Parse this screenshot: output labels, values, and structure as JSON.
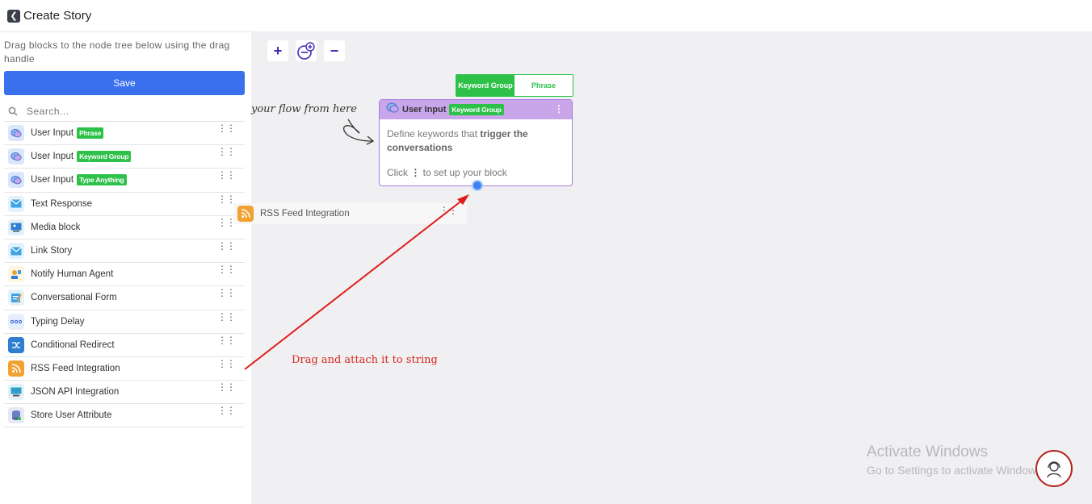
{
  "header": {
    "title": "Create Story",
    "back_icon": "arrow-left-icon"
  },
  "sidebar": {
    "hint": "Drag blocks to the node tree below using the drag handle",
    "save_label": "Save",
    "search_placeholder": "Search...",
    "blocks": [
      {
        "label": "User Input",
        "tag": "Phrase",
        "icon": "chat-bubble-icon"
      },
      {
        "label": "User Input",
        "tag": "Keyword Group",
        "icon": "chat-bubble-icon"
      },
      {
        "label": "User Input",
        "tag": "Type Anything",
        "icon": "chat-bubble-icon"
      },
      {
        "label": "Text Response",
        "tag": "",
        "icon": "envelope-icon"
      },
      {
        "label": "Media block",
        "tag": "",
        "icon": "media-icon"
      },
      {
        "label": "Link Story",
        "tag": "",
        "icon": "envelope-icon"
      },
      {
        "label": "Notify Human Agent",
        "tag": "",
        "icon": "agent-icon"
      },
      {
        "label": "Conversational Form",
        "tag": "",
        "icon": "form-icon"
      },
      {
        "label": "Typing Delay",
        "tag": "",
        "icon": "typing-dots-icon"
      },
      {
        "label": "Conditional Redirect",
        "tag": "",
        "icon": "shuffle-icon"
      },
      {
        "label": "RSS Feed Integration",
        "tag": "",
        "icon": "rss-icon"
      },
      {
        "label": "JSON API Integration",
        "tag": "",
        "icon": "api-monitor-icon"
      },
      {
        "label": "Store User Attribute",
        "tag": "",
        "icon": "database-icon"
      }
    ]
  },
  "canvas": {
    "start_label": "your flow from here",
    "toggle": {
      "active": "Keyword Group",
      "inactive": "Phrase"
    },
    "node": {
      "title": "User Input",
      "tag": "Keyword Group",
      "body_plain": "Define keywords that ",
      "body_bold": "trigger the conversations",
      "click_pre": "Click ",
      "click_post": " to set up your block"
    },
    "dragging_block": "RSS Feed Integration",
    "annotation": "Drag and attach it to string",
    "activate_title": "Activate Windows",
    "activate_sub": "Go to Settings to activate Windows."
  },
  "colors": {
    "accent": "#3a6fed",
    "tag_green": "#2ec14a",
    "node_purple": "#c9a5ea",
    "annotation_red": "#d7261d"
  }
}
